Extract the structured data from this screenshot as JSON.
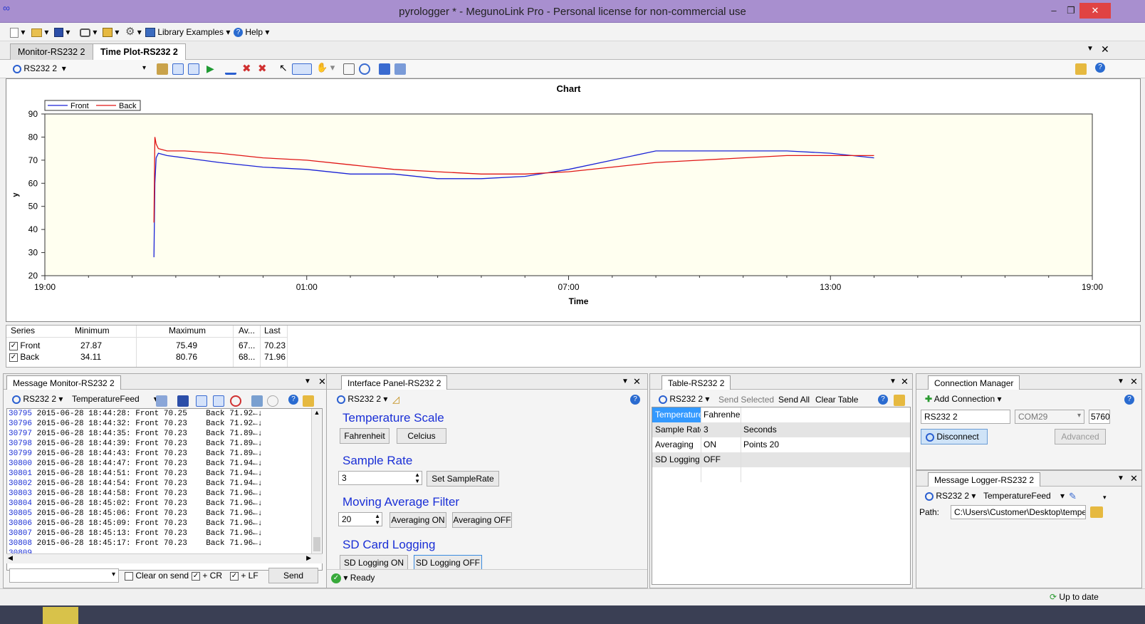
{
  "window": {
    "title": "pyrologger * - MegunoLink Pro - Personal license for non-commercial use",
    "min": "–",
    "max": "❐",
    "close": "✕"
  },
  "menu": {
    "library": "Library Examples",
    "help": "Help"
  },
  "doc_tabs": [
    "Monitor-RS232 2",
    "Time Plot-RS232 2"
  ],
  "plot_toolbar": {
    "connection": "RS232 2"
  },
  "chart_data": {
    "type": "line",
    "title": "Chart",
    "xlabel": "Time",
    "ylabel": "y",
    "x_ticks": [
      "19:00",
      "01:00",
      "07:00",
      "13:00",
      "19:00"
    ],
    "y_ticks": [
      20,
      30,
      40,
      50,
      60,
      70,
      80,
      90
    ],
    "ylim": [
      20,
      90
    ],
    "xlim_hours": [
      0,
      24
    ],
    "legend_position": "top-left",
    "grid": false,
    "series": [
      {
        "name": "Front",
        "color": "#1a22d6",
        "x_hours": [
          2.5,
          2.52,
          2.55,
          2.6,
          2.8,
          3.2,
          4,
          5,
          6,
          7,
          8,
          9,
          10,
          11,
          12,
          13,
          14,
          15,
          16,
          17,
          18,
          19
        ],
        "values": [
          28,
          60,
          71,
          73,
          72,
          71,
          69,
          67,
          66,
          64,
          64,
          62,
          62,
          63,
          66,
          70,
          74,
          74,
          74,
          74,
          73,
          71
        ]
      },
      {
        "name": "Back",
        "color": "#e01515",
        "x_hours": [
          2.5,
          2.52,
          2.55,
          2.6,
          2.8,
          3.2,
          4,
          5,
          6,
          7,
          8,
          9,
          10,
          11,
          12,
          13,
          14,
          15,
          16,
          17,
          18,
          19
        ],
        "values": [
          43,
          80,
          77,
          75,
          74,
          74,
          73,
          71,
          70,
          68,
          66,
          65,
          64,
          64,
          65,
          67,
          69,
          70,
          71,
          72,
          72,
          72
        ]
      }
    ]
  },
  "stats": {
    "headers": [
      "Series",
      "Minimum",
      "Maximum",
      "Av...",
      "Last"
    ],
    "rows": [
      {
        "name": "Front",
        "min": "27.87",
        "max": "75.49",
        "avg": "67...",
        "last": "70.23"
      },
      {
        "name": "Back",
        "min": "34.11",
        "max": "80.76",
        "avg": "68...",
        "last": "71.96"
      }
    ]
  },
  "monitor": {
    "tab": "Message Monitor-RS232 2",
    "connection": "RS232 2",
    "feed": "TemperatureFeed",
    "lines": [
      {
        "n": "30795",
        "t": "2015-06-28 18:44:28: Front 70.25    Back 71.92←↓"
      },
      {
        "n": "30796",
        "t": "2015-06-28 18:44:32: Front 70.23    Back 71.92←↓"
      },
      {
        "n": "30797",
        "t": "2015-06-28 18:44:35: Front 70.23    Back 71.89←↓"
      },
      {
        "n": "30798",
        "t": "2015-06-28 18:44:39: Front 70.23    Back 71.89←↓"
      },
      {
        "n": "30799",
        "t": "2015-06-28 18:44:43: Front 70.23    Back 71.89←↓"
      },
      {
        "n": "30800",
        "t": "2015-06-28 18:44:47: Front 70.23    Back 71.94←↓"
      },
      {
        "n": "30801",
        "t": "2015-06-28 18:44:51: Front 70.23    Back 71.94←↓"
      },
      {
        "n": "30802",
        "t": "2015-06-28 18:44:54: Front 70.23    Back 71.94←↓"
      },
      {
        "n": "30803",
        "t": "2015-06-28 18:44:58: Front 70.23    Back 71.96←↓"
      },
      {
        "n": "30804",
        "t": "2015-06-28 18:45:02: Front 70.23    Back 71.96←↓"
      },
      {
        "n": "30805",
        "t": "2015-06-28 18:45:06: Front 70.23    Back 71.96←↓"
      },
      {
        "n": "30806",
        "t": "2015-06-28 18:45:09: Front 70.23    Back 71.96←↓"
      },
      {
        "n": "30807",
        "t": "2015-06-28 18:45:13: Front 70.23    Back 71.96←↓"
      },
      {
        "n": "30808",
        "t": "2015-06-28 18:45:17: Front 70.23    Back 71.96←↓"
      },
      {
        "n": "30809",
        "t": ""
      }
    ],
    "clear_on_send": "Clear on send",
    "cr": "+ CR",
    "lf": "+ LF",
    "send": "Send"
  },
  "interface": {
    "tab": "Interface Panel-RS232 2",
    "connection": "RS232 2",
    "temp_heading": "Temperature Scale",
    "fahrenheit": "Fahrenheit",
    "celcius": "Celcius",
    "sample_heading": "Sample Rate",
    "sample_value": "3",
    "set_sample": "Set SampleRate",
    "avg_heading": "Moving Average Filter",
    "avg_value": "20",
    "avg_on": "Averaging ON",
    "avg_off": "Averaging OFF",
    "sd_heading": "SD Card Logging",
    "sd_on": "SD Logging ON",
    "sd_off": "SD Logging OFF",
    "status": "Ready"
  },
  "table": {
    "tab": "Table-RS232 2",
    "connection": "RS232 2",
    "send_selected": "Send Selected",
    "send_all": "Send All",
    "clear_table": "Clear Table",
    "rows": [
      [
        "Temperature",
        "Fahrenheit",
        ""
      ],
      [
        "Sample Rate",
        "3",
        "Seconds"
      ],
      [
        "Averaging",
        "ON",
        "Points 20"
      ],
      [
        "SD Logging",
        "OFF",
        ""
      ]
    ]
  },
  "connection_manager": {
    "tab": "Connection Manager",
    "add": "Add Connection",
    "name": "RS232 2",
    "port": "COM29",
    "baud": "5760",
    "disconnect": "Disconnect",
    "advanced": "Advanced"
  },
  "logger": {
    "tab": "Message Logger-RS232 2",
    "connection": "RS232 2",
    "feed": "TemperatureFeed",
    "path_label": "Path:",
    "path": "C:\\Users\\Customer\\Desktop\\tempeh..."
  },
  "statusbar": {
    "uptodate": "Up to date"
  }
}
